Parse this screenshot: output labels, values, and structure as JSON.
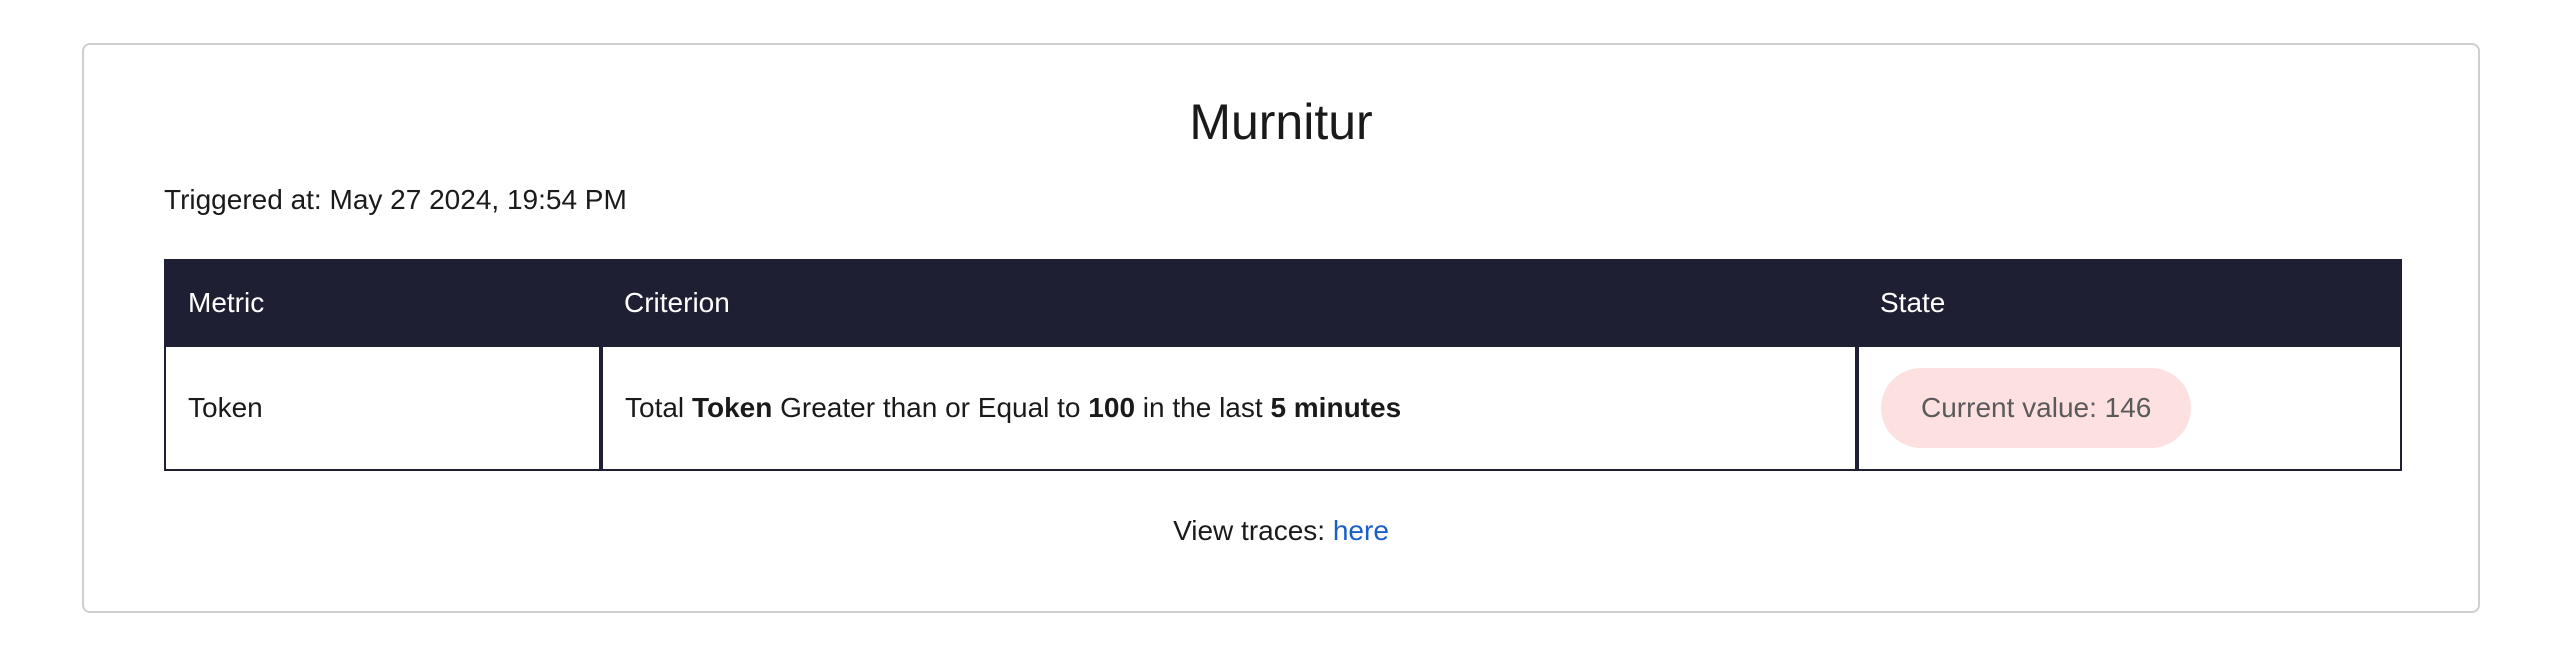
{
  "alert": {
    "title": "Murnitur",
    "triggered_label": "Triggered at:",
    "triggered_value": "May 27 2024, 19:54 PM"
  },
  "table": {
    "headers": {
      "metric": "Metric",
      "criterion": "Criterion",
      "state": "State"
    },
    "row": {
      "metric": "Token",
      "criterion": {
        "prefix": "Total",
        "metric": "Token",
        "comparison": "Greater than or Equal to",
        "threshold": "100",
        "window_prefix": "in the last",
        "window": "5 minutes"
      },
      "state_text": "Current value: 146"
    }
  },
  "footer": {
    "label": "View traces:",
    "link_text": "here"
  },
  "colors": {
    "header_bg": "#1f1f33",
    "pill_bg": "#fde0e0",
    "link": "#1a5fc8"
  }
}
